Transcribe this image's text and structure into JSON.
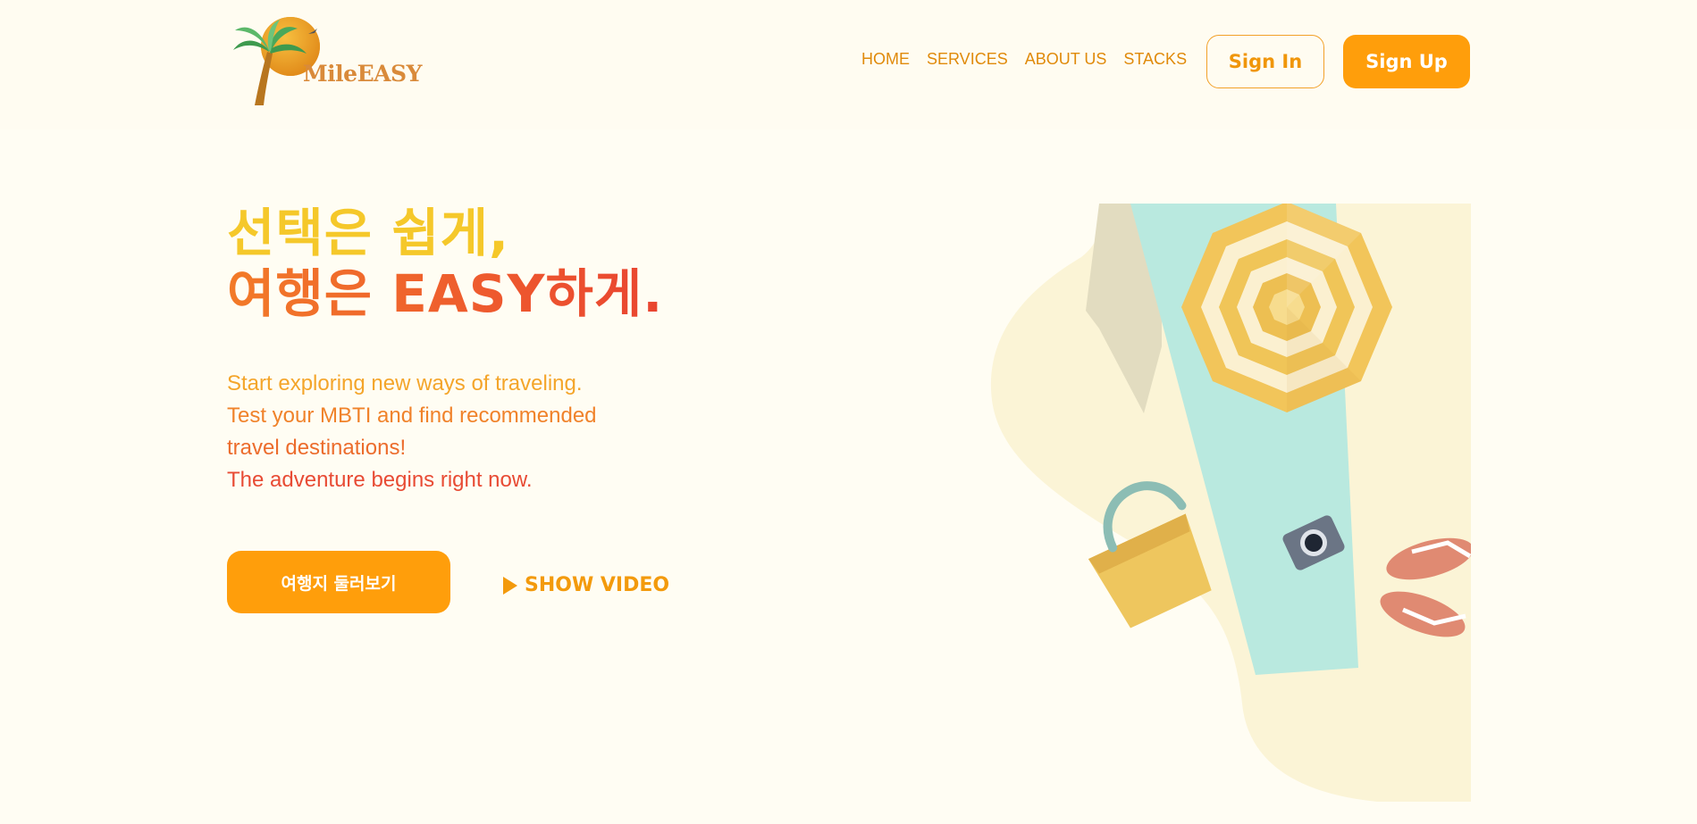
{
  "brand": {
    "name": "MileEASY"
  },
  "nav": {
    "items": [
      {
        "label": "HOME"
      },
      {
        "label": "SERVICES"
      },
      {
        "label": "ABOUT US"
      },
      {
        "label": "STACKS"
      }
    ]
  },
  "auth": {
    "sign_in_label": "Sign In",
    "sign_up_label": "Sign Up"
  },
  "hero": {
    "headline_line1": "선택은 쉽게,",
    "headline_line2": "여행은 EASY하게.",
    "description": [
      "Start exploring new ways of traveling.",
      "Test your MBTI and find recommended",
      "travel destinations!",
      "The adventure begins right now."
    ],
    "explore_button_label": "여행지 둘러보기",
    "show_video_label": "SHOW VIDEO"
  },
  "colors": {
    "accent": "#ff9e0b",
    "headline_yellow": "#f5c82a",
    "headline_red": "#e94430",
    "background": "#fffdf3"
  },
  "icons": {
    "logo": "palm-tree-sun-logo",
    "play": "play-icon"
  }
}
